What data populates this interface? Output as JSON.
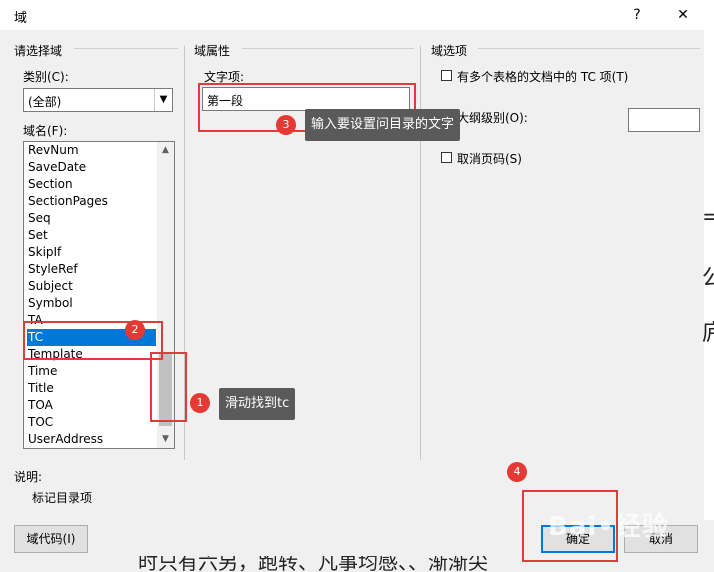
{
  "window": {
    "title": "域",
    "help_icon": "?",
    "close_icon": "✕"
  },
  "left_panel": {
    "group_label": "请选择域",
    "category_label": "类别(C):",
    "category_value": "(全部)",
    "field_names_label": "域名(F):",
    "field_names": [
      "RevNum",
      "SaveDate",
      "Section",
      "SectionPages",
      "Seq",
      "Set",
      "SkipIf",
      "StyleRef",
      "Subject",
      "Symbol",
      "TA",
      "TC",
      "Template",
      "Time",
      "Title",
      "TOA",
      "TOC",
      "UserAddress"
    ],
    "selected_field": "TC"
  },
  "middle_panel": {
    "group_label": "域属性",
    "text_item_label": "文字项:",
    "text_item_value": "第一段"
  },
  "right_panel": {
    "group_label": "域选项",
    "option1_label": "有多个表格的文档中的 TC 项(T)",
    "option2_label": "大纲级别(O):",
    "option3_label": "取消页码(S)",
    "level_value": ""
  },
  "description": {
    "label": "说明:",
    "text": "标记目录项"
  },
  "buttons": {
    "field_codes": "域代码(I)",
    "ok": "确定",
    "cancel": "取消"
  },
  "annotations": {
    "step1": {
      "number": "1",
      "text": "滑动找到tc"
    },
    "step2": {
      "number": "2"
    },
    "step3": {
      "number": "3",
      "text": "输入要设置问目录的文字"
    },
    "step4": {
      "number": "4"
    }
  },
  "colors": {
    "selection": "#0078d7",
    "annotation_red": "#e03c3c",
    "tooltip_bg": "#5a5a5a"
  },
  "background_doc": {
    "bottom_text": "时只有六另，跑转、凡事均感、、渐渐尖",
    "watermark": "Bai 经验"
  }
}
